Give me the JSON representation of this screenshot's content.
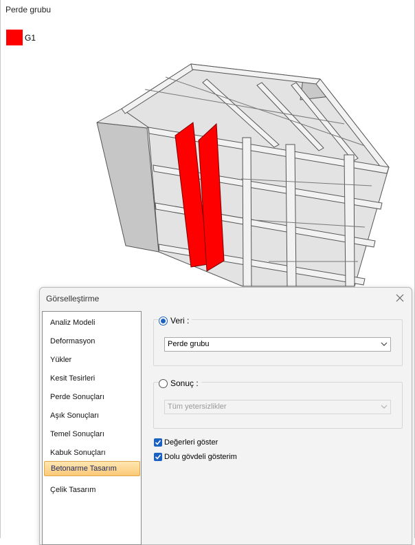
{
  "viewport": {
    "title": "Perde grubu",
    "legend": [
      {
        "label": "G1",
        "color": "#ff0000"
      }
    ]
  },
  "dialog": {
    "title": "Görselleştirme",
    "nav": {
      "items": [
        "Analiz Modeli",
        "Deformasyon",
        "Yükler",
        "Kesit Tesirleri",
        "Perde Sonuçları",
        "Aşık Sonuçları",
        "Temel Sonuçları",
        "Kabuk Sonuçları",
        "Betonarme Tasarım",
        "Çelik Tasarım"
      ],
      "selected": "Betonarme Tasarım"
    },
    "veri": {
      "label": "Veri :",
      "selected": true,
      "value": "Perde grubu"
    },
    "sonuc": {
      "label": "Sonuç :",
      "selected": false,
      "value": "Tüm yetersizlikler",
      "enabled": false
    },
    "checkboxes": [
      {
        "label": "Değerleri göster",
        "checked": true
      },
      {
        "label": "Dolu gövdeli gösterim",
        "checked": true
      }
    ]
  },
  "colors": {
    "accent": "#1a61c0",
    "highlight": "#ff0000",
    "structure": "#d9d9d9",
    "edge": "#555555"
  }
}
